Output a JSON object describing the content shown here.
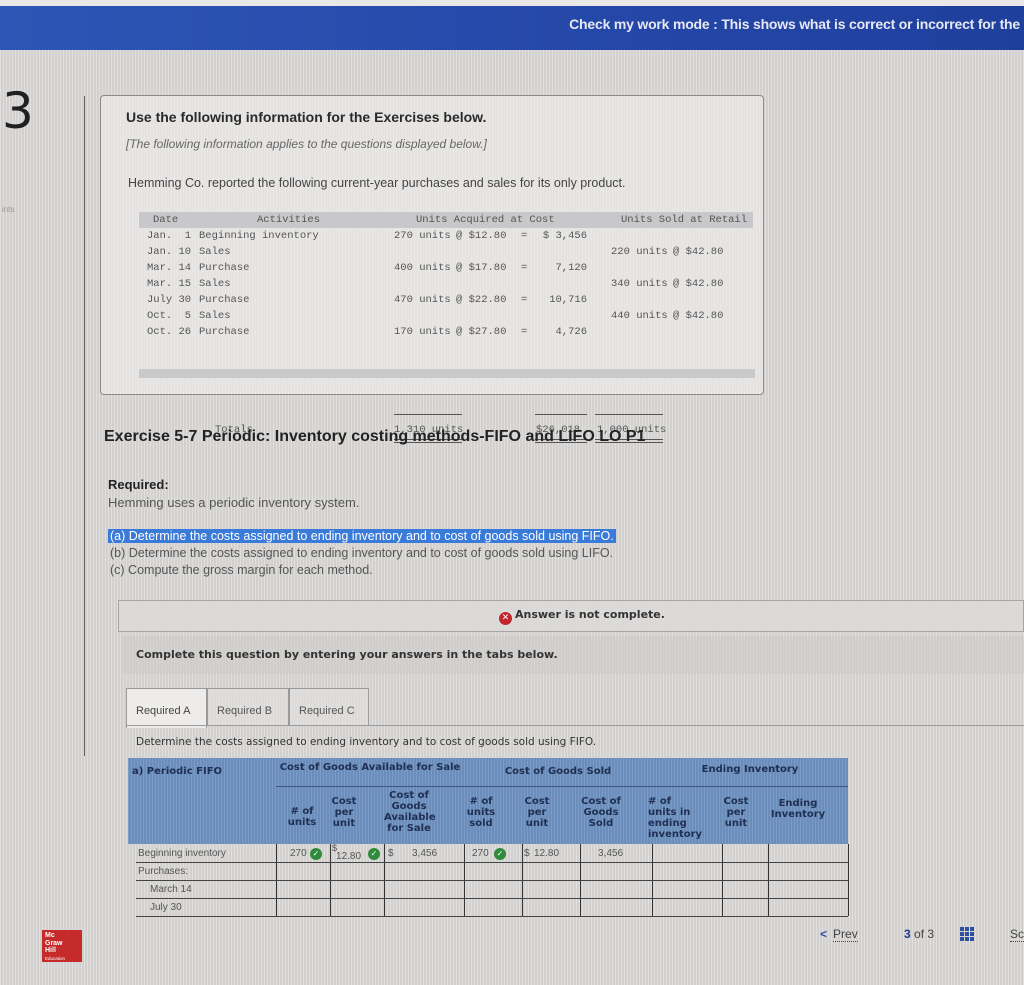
{
  "header": {
    "mode_text": "Check my work mode : This shows what is correct or incorrect for the"
  },
  "question": {
    "number": "3",
    "points_label": "ints"
  },
  "info": {
    "title": "Use the following information for the Exercises below.",
    "subtitle": "[The following information applies to the questions displayed below.]",
    "description": "Hemming Co. reported the following current-year purchases and sales for its only product.",
    "table": {
      "headers": {
        "date": "Date",
        "activities": "Activities",
        "acquired": "Units Acquired at Cost",
        "sold": "Units Sold at Retail"
      },
      "rows": [
        {
          "date": "Jan.  1",
          "activity": "Beginning inventory",
          "acq_units": "270 units",
          "acq_cost": "@ $12.80",
          "eq": "=",
          "acq_total": "$ 3,456",
          "sold_units": "",
          "sold_price": ""
        },
        {
          "date": "Jan. 10",
          "activity": "Sales",
          "acq_units": "",
          "acq_cost": "",
          "eq": "",
          "acq_total": "",
          "sold_units": "220 units",
          "sold_price": "@ $42.80"
        },
        {
          "date": "Mar. 14",
          "activity": "Purchase",
          "acq_units": "400 units",
          "acq_cost": "@ $17.80",
          "eq": "=",
          "acq_total": "7,120",
          "sold_units": "",
          "sold_price": ""
        },
        {
          "date": "Mar. 15",
          "activity": "Sales",
          "acq_units": "",
          "acq_cost": "",
          "eq": "",
          "acq_total": "",
          "sold_units": "340 units",
          "sold_price": "@ $42.80"
        },
        {
          "date": "July 30",
          "activity": "Purchase",
          "acq_units": "470 units",
          "acq_cost": "@ $22.80",
          "eq": "=",
          "acq_total": "10,716",
          "sold_units": "",
          "sold_price": ""
        },
        {
          "date": "Oct.  5",
          "activity": "Sales",
          "acq_units": "",
          "acq_cost": "",
          "eq": "",
          "acq_total": "",
          "sold_units": "440 units",
          "sold_price": "@ $42.80"
        },
        {
          "date": "Oct. 26",
          "activity": "Purchase",
          "acq_units": "170 units",
          "acq_cost": "@ $27.80",
          "eq": "=",
          "acq_total": "4,726",
          "sold_units": "",
          "sold_price": ""
        }
      ],
      "totals": {
        "label": "Totals",
        "acq_units": "1,310 units",
        "acq_total": "$26,018",
        "sold_units": "1,000 units"
      }
    }
  },
  "exercise": {
    "title": "Exercise 5-7 Periodic: Inventory costing methods-FIFO and LIFO LO P1",
    "required_label": "Required:",
    "required_desc": "Hemming uses a periodic inventory system.",
    "parts": [
      "(a) Determine the costs assigned to ending inventory and to cost of goods sold using FIFO.",
      "(b) Determine the costs assigned to ending inventory and to cost of goods sold using LIFO.",
      "(c) Compute the gross margin for each method."
    ]
  },
  "status": {
    "answer_message": "Answer is not complete.",
    "complete_message": "Complete this question by entering your answers in the tabs below."
  },
  "tabs": [
    {
      "label": "Required A",
      "active": true
    },
    {
      "label": "Required B",
      "active": false
    },
    {
      "label": "Required C",
      "active": false
    }
  ],
  "instruction": "Determine the costs assigned to ending inventory and to cost of goods sold using FIFO.",
  "grid": {
    "title": "a) Periodic FIFO",
    "groups": {
      "available": "Cost of Goods Available for Sale",
      "cogs": "Cost of Goods Sold",
      "ending": "Ending Inventory"
    },
    "columns": {
      "avail_units": "# of units",
      "avail_cost": "Cost per unit",
      "avail_total": "Cost of Goods Available for Sale",
      "sold_units": "# of units sold",
      "sold_cost": "Cost per unit",
      "sold_total": "Cost of Goods Sold",
      "end_units": "# of units in ending inventory",
      "end_cost": "Cost per unit",
      "end_total": "Ending Inventory"
    },
    "rows": [
      {
        "label": "Beginning inventory",
        "avail_units": "270",
        "avail_cost": "12.80",
        "avail_total": "3,456",
        "sold_units": "270",
        "sold_cost": "12.80",
        "sold_total": "3,456",
        "end_units": "",
        "end_cost": "",
        "end_total": ""
      },
      {
        "label": "Purchases:",
        "avail_units": "",
        "avail_cost": "",
        "avail_total": "",
        "sold_units": "",
        "sold_cost": "",
        "sold_total": "",
        "end_units": "",
        "end_cost": "",
        "end_total": ""
      },
      {
        "label": "March 14",
        "avail_units": "",
        "avail_cost": "",
        "avail_total": "",
        "sold_units": "",
        "sold_cost": "",
        "sold_total": "",
        "end_units": "",
        "end_cost": "",
        "end_total": ""
      },
      {
        "label": "July 30",
        "avail_units": "",
        "avail_cost": "",
        "avail_total": "",
        "sold_units": "",
        "sold_cost": "",
        "sold_total": "",
        "end_units": "",
        "end_cost": "",
        "end_total": ""
      }
    ],
    "currency": "$"
  },
  "footer": {
    "prev_label": "Prev",
    "page_current": "3",
    "page_of": "of",
    "page_total": "3",
    "next_partial": "Sc"
  },
  "logo": {
    "line1": "Mc",
    "line2": "Graw",
    "line3": "Hill",
    "line4": "Education",
    "color": "#c62b2b"
  },
  "colors": {
    "header_blue": "#2447a8",
    "grid_header": "#6f93c2",
    "selection": "#3a7ad8",
    "check_green": "#2f8a3c",
    "error_red": "#c0262c"
  }
}
